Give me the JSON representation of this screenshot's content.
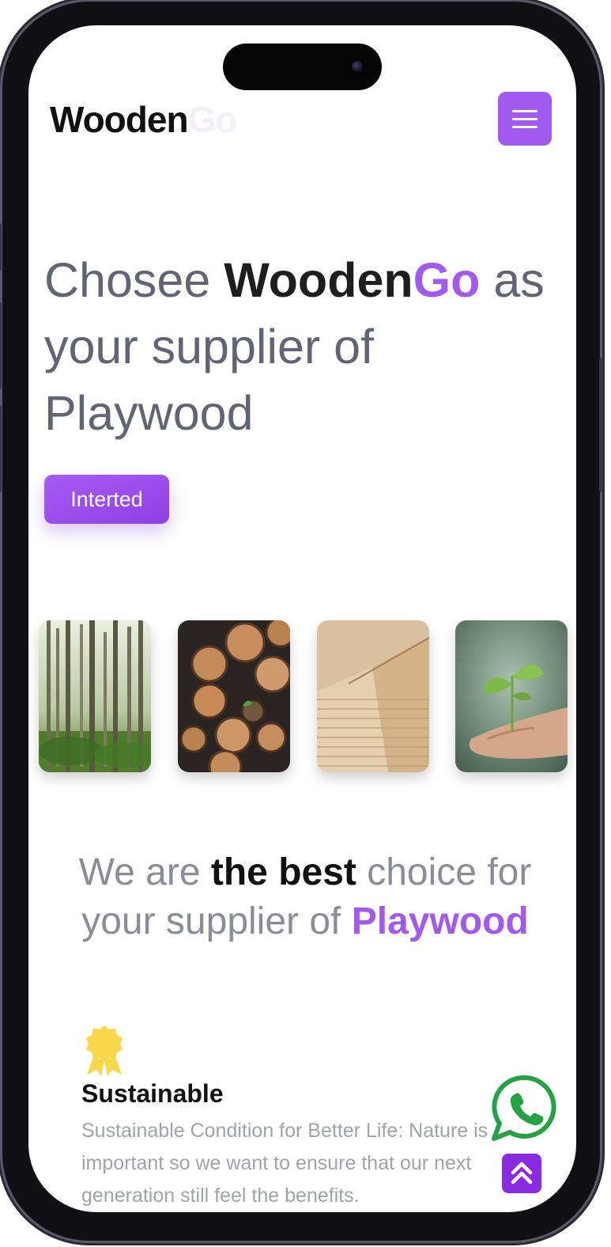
{
  "header": {
    "brand_main": "Wooden",
    "brand_accent": "Go",
    "menu_icon": "hamburger-menu-icon"
  },
  "hero": {
    "text_before": "Chosee ",
    "brand_main": "Wooden",
    "brand_accent": "Go",
    "text_after": " as your supplier of Playwood",
    "cta_label": "Interted"
  },
  "gallery": {
    "images": [
      "forest-image",
      "logs-image",
      "plywood-stack-image",
      "seedling-in-hand-image"
    ]
  },
  "intro": {
    "text_before": "We are ",
    "bold": "the best",
    "text_middle": " choice for your supplier of ",
    "accent": "Playwood"
  },
  "feature": {
    "icon": "award-badge-icon",
    "title": "Sustainable",
    "description": "Sustainable Condition for Better Life: Nature is important so we want to ensure that our next generation still feel the benefits."
  },
  "floating": {
    "whatsapp_icon": "whatsapp-icon",
    "scroll_top_icon": "double-chevron-up-icon"
  },
  "colors": {
    "accent": "#a259f0",
    "accent_dark": "#8a2be2",
    "brand_accent_faded": "#f3eef9",
    "text_gray": "#606474",
    "whatsapp_green": "#25a244",
    "badge_yellow": "#f9d648"
  }
}
